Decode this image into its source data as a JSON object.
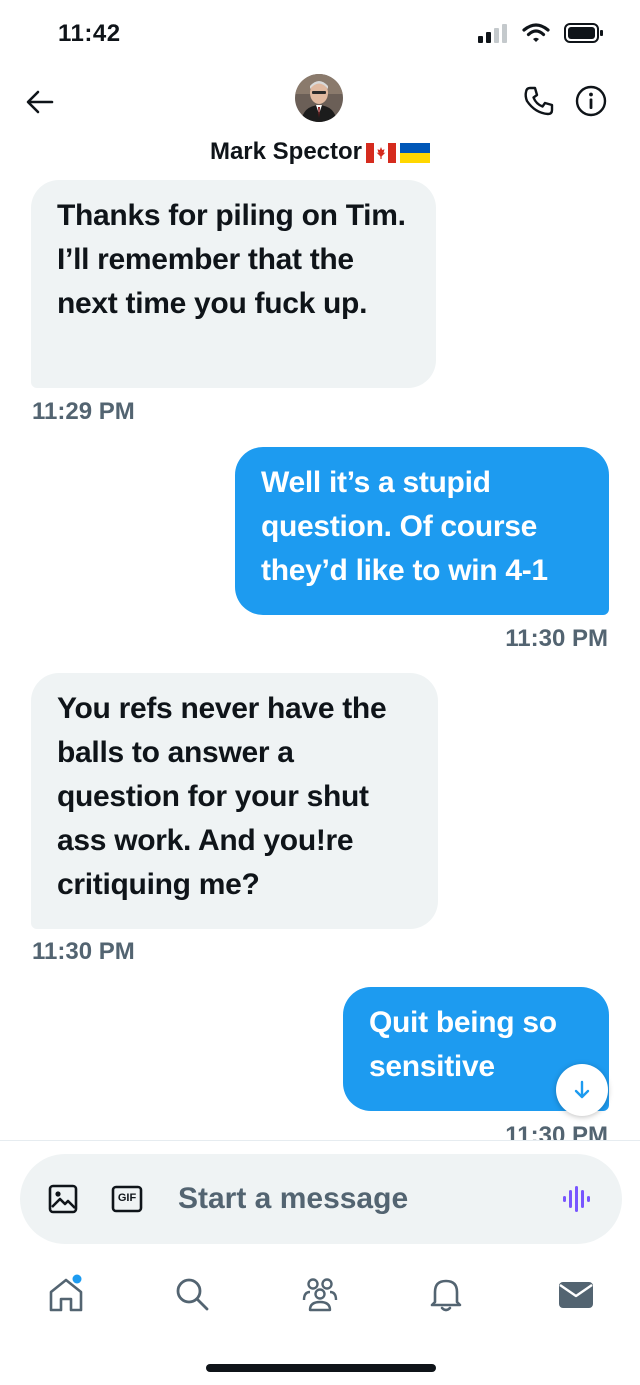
{
  "status_bar": {
    "time": "11:42"
  },
  "header": {
    "contact_name": "Mark Spector",
    "flags": [
      "canada-flag",
      "ukraine-flag"
    ]
  },
  "messages": [
    {
      "direction": "received",
      "text": "Thanks for piling on Tim. I’ll remember that the next time you fuck up.",
      "time": "11:29 PM"
    },
    {
      "direction": "sent",
      "text": "Well it’s a stupid question. Of course they’d like to win 4-1",
      "time": "11:30 PM"
    },
    {
      "direction": "received",
      "text": "You refs never have the balls to answer a question for your shut ass work. And you!re critiquing me?",
      "time": "11:30 PM"
    },
    {
      "direction": "sent",
      "text": "Quit being so sensitive",
      "time": "11:30 PM"
    }
  ],
  "composer": {
    "placeholder": "Start a message",
    "gif_label": "GIF"
  },
  "colors": {
    "accent": "#1d9bf0",
    "received_bubble": "#eff3f4",
    "muted_text": "#536471",
    "voice_icon": "#7856ff"
  },
  "tab_bar": {
    "items": [
      "home-icon",
      "search-icon",
      "communities-icon",
      "notifications-icon",
      "messages-icon"
    ]
  }
}
